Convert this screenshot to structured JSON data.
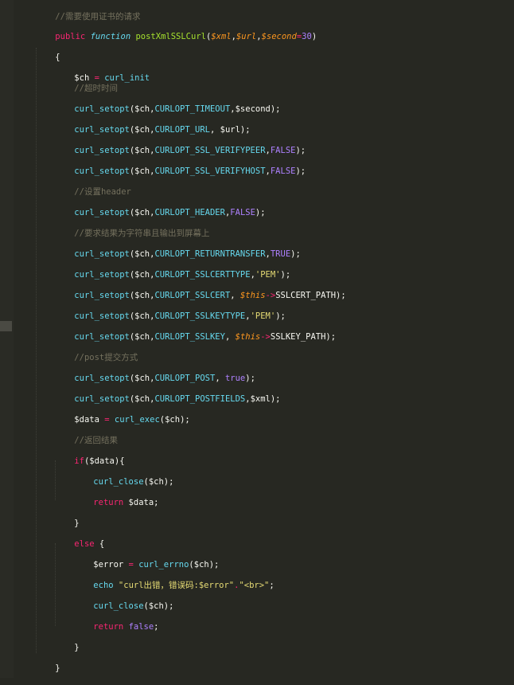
{
  "code": {
    "comment_cert": "//需要使用证书的请求",
    "kw_public": "public",
    "kw_function": "function",
    "func_name": "postXmlSSLCurl",
    "open_paren": "(",
    "param_xml": "$xml",
    "comma": ",",
    "param_url": "$url",
    "param_second": "$second",
    "eq": "=",
    "num_30": "30",
    "close_paren": ")",
    "brace_open": "{",
    "brace_close": "}",
    "var_ch": "$ch",
    "assign": " = ",
    "call_curl_init": "curl_init",
    "comment_timeout": "//超时时间",
    "fn_setopt": "curl_setopt",
    "args_ch": "($ch,",
    "opt_timeout": "CURLOPT_TIMEOUT",
    "tail_timeout": ",$second);",
    "opt_url": "CURLOPT_URL",
    "tail_url": ", $url);",
    "opt_verifypeer": "CURLOPT_SSL_VERIFYPEER",
    "opt_verifyhost": "CURLOPT_SSL_VERIFYHOST",
    "const_false": "FALSE",
    "const_true": "TRUE",
    "tail_close": ");",
    "comment_header": "//设置header",
    "opt_header": "CURLOPT_HEADER",
    "comment_return": "//要求结果为字符串且输出到屏幕上",
    "opt_returntransfer": "CURLOPT_RETURNTRANSFER",
    "opt_sslcerttype": "CURLOPT_SSLCERTTYPE",
    "str_pem": "'PEM'",
    "opt_sslcert": "CURLOPT_SSLCERT",
    "sep_space": ", ",
    "this_var": "$this",
    "arrow": "->",
    "prop_cert_path": "SSLCERT_PATH);",
    "opt_sslkeytype": "CURLOPT_SSLKEYTYPE",
    "opt_sslkey": "CURLOPT_SSLKEY",
    "prop_key_path": "SSLKEY_PATH);",
    "comment_post": "//post提交方式",
    "opt_post": "CURLOPT_POST",
    "kw_true_lower": "true",
    "opt_postfields": "CURLOPT_POSTFIELDS",
    "tail_xml": ",$xml);",
    "var_data": "$data",
    "fn_curl_exec": "curl_exec",
    "args_ch_only": "($ch);",
    "comment_back": "//返回结果",
    "kw_if": "if",
    "if_cond": "($data){",
    "fn_curl_close": "curl_close",
    "kw_return": "return",
    "return_data": " $data;",
    "kw_else": "else",
    "else_brace": " {",
    "var_error": "$error",
    "fn_curl_errno": "curl_errno",
    "kw_echo": "echo",
    "str_err_msg": "\"curl出错，错误码:$error\"",
    "concat": ".",
    "str_br": "\"<br>\"",
    "semicolon": ";",
    "kw_false_lower": "false"
  }
}
